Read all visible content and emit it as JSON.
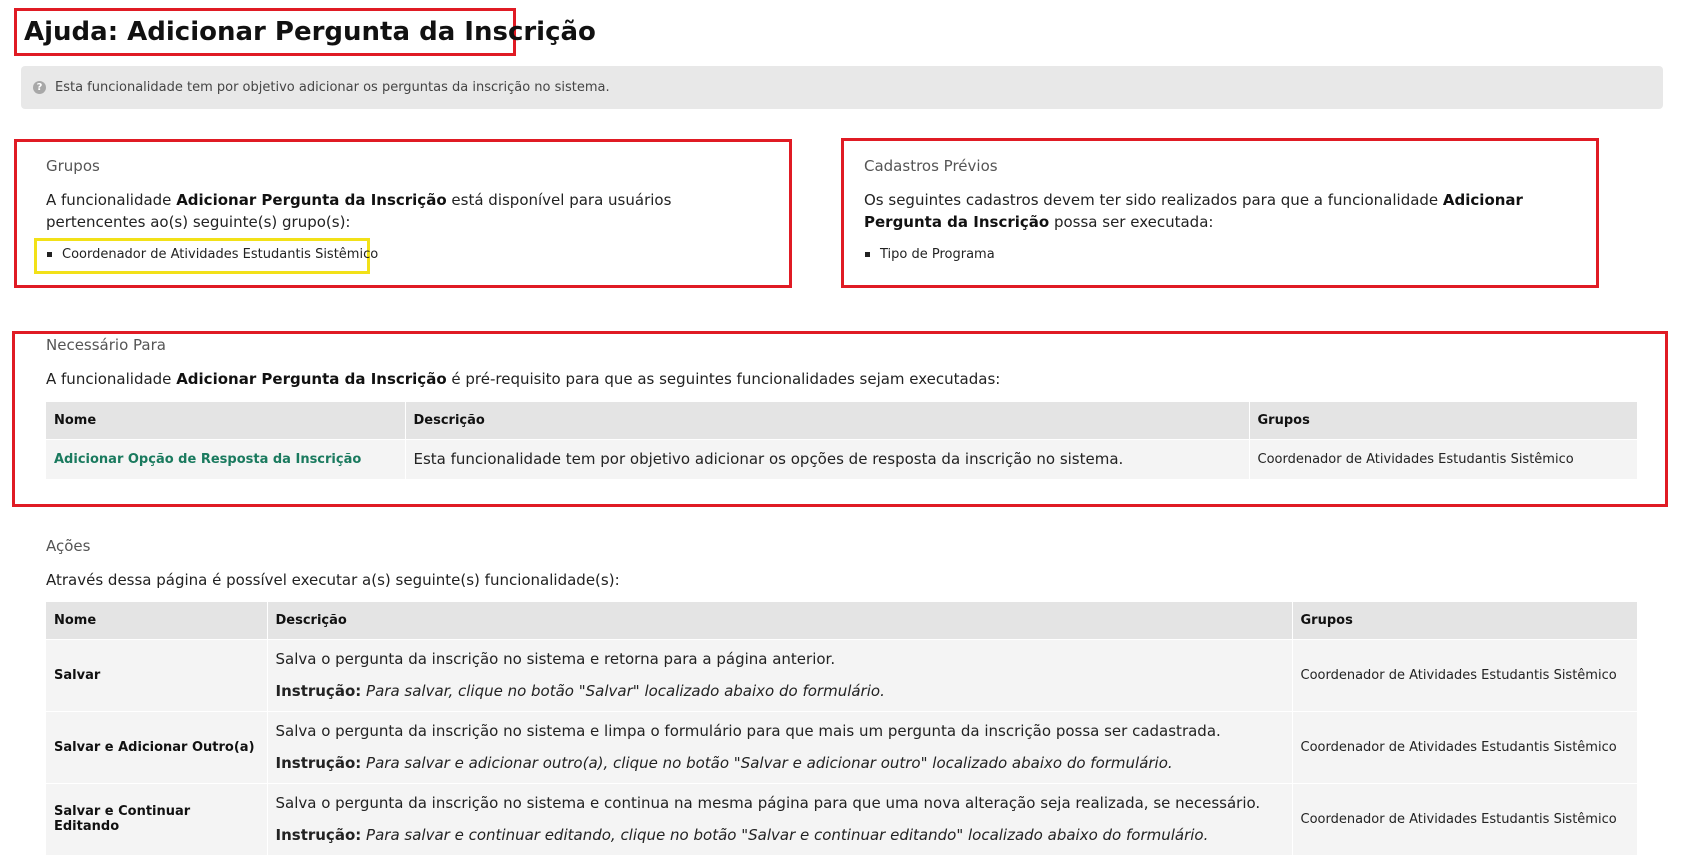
{
  "page": {
    "title": "Ajuda: Adicionar Pergunta da Inscrição",
    "info_text": "Esta funcionalidade tem por objetivo adicionar os perguntas da inscrição no sistema.",
    "info_icon": "question-circle-icon"
  },
  "grupos": {
    "title": "Grupos",
    "text_before": "A funcionalidade ",
    "feature_name": "Adicionar Pergunta da Inscrição",
    "text_after": " está disponível para usuários pertencentes ao(s) seguinte(s) grupo(s):",
    "items": [
      "Coordenador de Atividades Estudantis Sistêmico"
    ]
  },
  "cadastros": {
    "title": "Cadastros Prévios",
    "text_before": "Os seguintes cadastros devem ter sido realizados para que a funcionalidade ",
    "feature_name": "Adicionar Pergunta da Inscrição",
    "text_after": " possa ser executada:",
    "items": [
      "Tipo de Programa"
    ]
  },
  "necessario": {
    "title": "Necessário Para",
    "text_before": "A funcionalidade ",
    "feature_name": "Adicionar Pergunta da Inscrição",
    "text_after": " é pré-requisito para que as seguintes funcionalidades sejam executadas:",
    "columns": [
      "Nome",
      "Descrição",
      "Grupos"
    ],
    "rows": [
      {
        "name": "Adicionar Opção de Resposta da Inscrição",
        "description": "Esta funcionalidade tem por objetivo adicionar os opções de resposta da inscrição no sistema.",
        "groups": "Coordenador de Atividades Estudantis Sistêmico"
      }
    ]
  },
  "acoes": {
    "title": "Ações",
    "text": "Através dessa página é possível executar a(s) seguinte(s) funcionalidade(s):",
    "columns": [
      "Nome",
      "Descrição",
      "Grupos"
    ],
    "instruction_label": "Instrução:",
    "rows": [
      {
        "name": "Salvar",
        "description": "Salva o pergunta da inscrição no sistema e retorna para a página anterior.",
        "instruction": "Para salvar, clique no botão \"Salvar\" localizado abaixo do formulário.",
        "groups": "Coordenador de Atividades Estudantis Sistêmico"
      },
      {
        "name": "Salvar e Adicionar Outro(a)",
        "description": "Salva o pergunta da inscrição no sistema e limpa o formulário para que mais um pergunta da inscrição possa ser cadastrada.",
        "instruction": "Para salvar e adicionar outro(a), clique no botão \"Salvar e adicionar outro\" localizado abaixo do formulário.",
        "groups": "Coordenador de Atividades Estudantis Sistêmico"
      },
      {
        "name": "Salvar e Continuar Editando",
        "description": "Salva o pergunta da inscrição no sistema e continua na mesma página para que uma nova alteração seja realizada, se necessário.",
        "instruction": "Para salvar e continuar editando, clique no botão \"Salvar e continuar editando\" localizado abaixo do formulário.",
        "groups": "Coordenador de Atividades Estudantis Sistêmico"
      }
    ]
  }
}
